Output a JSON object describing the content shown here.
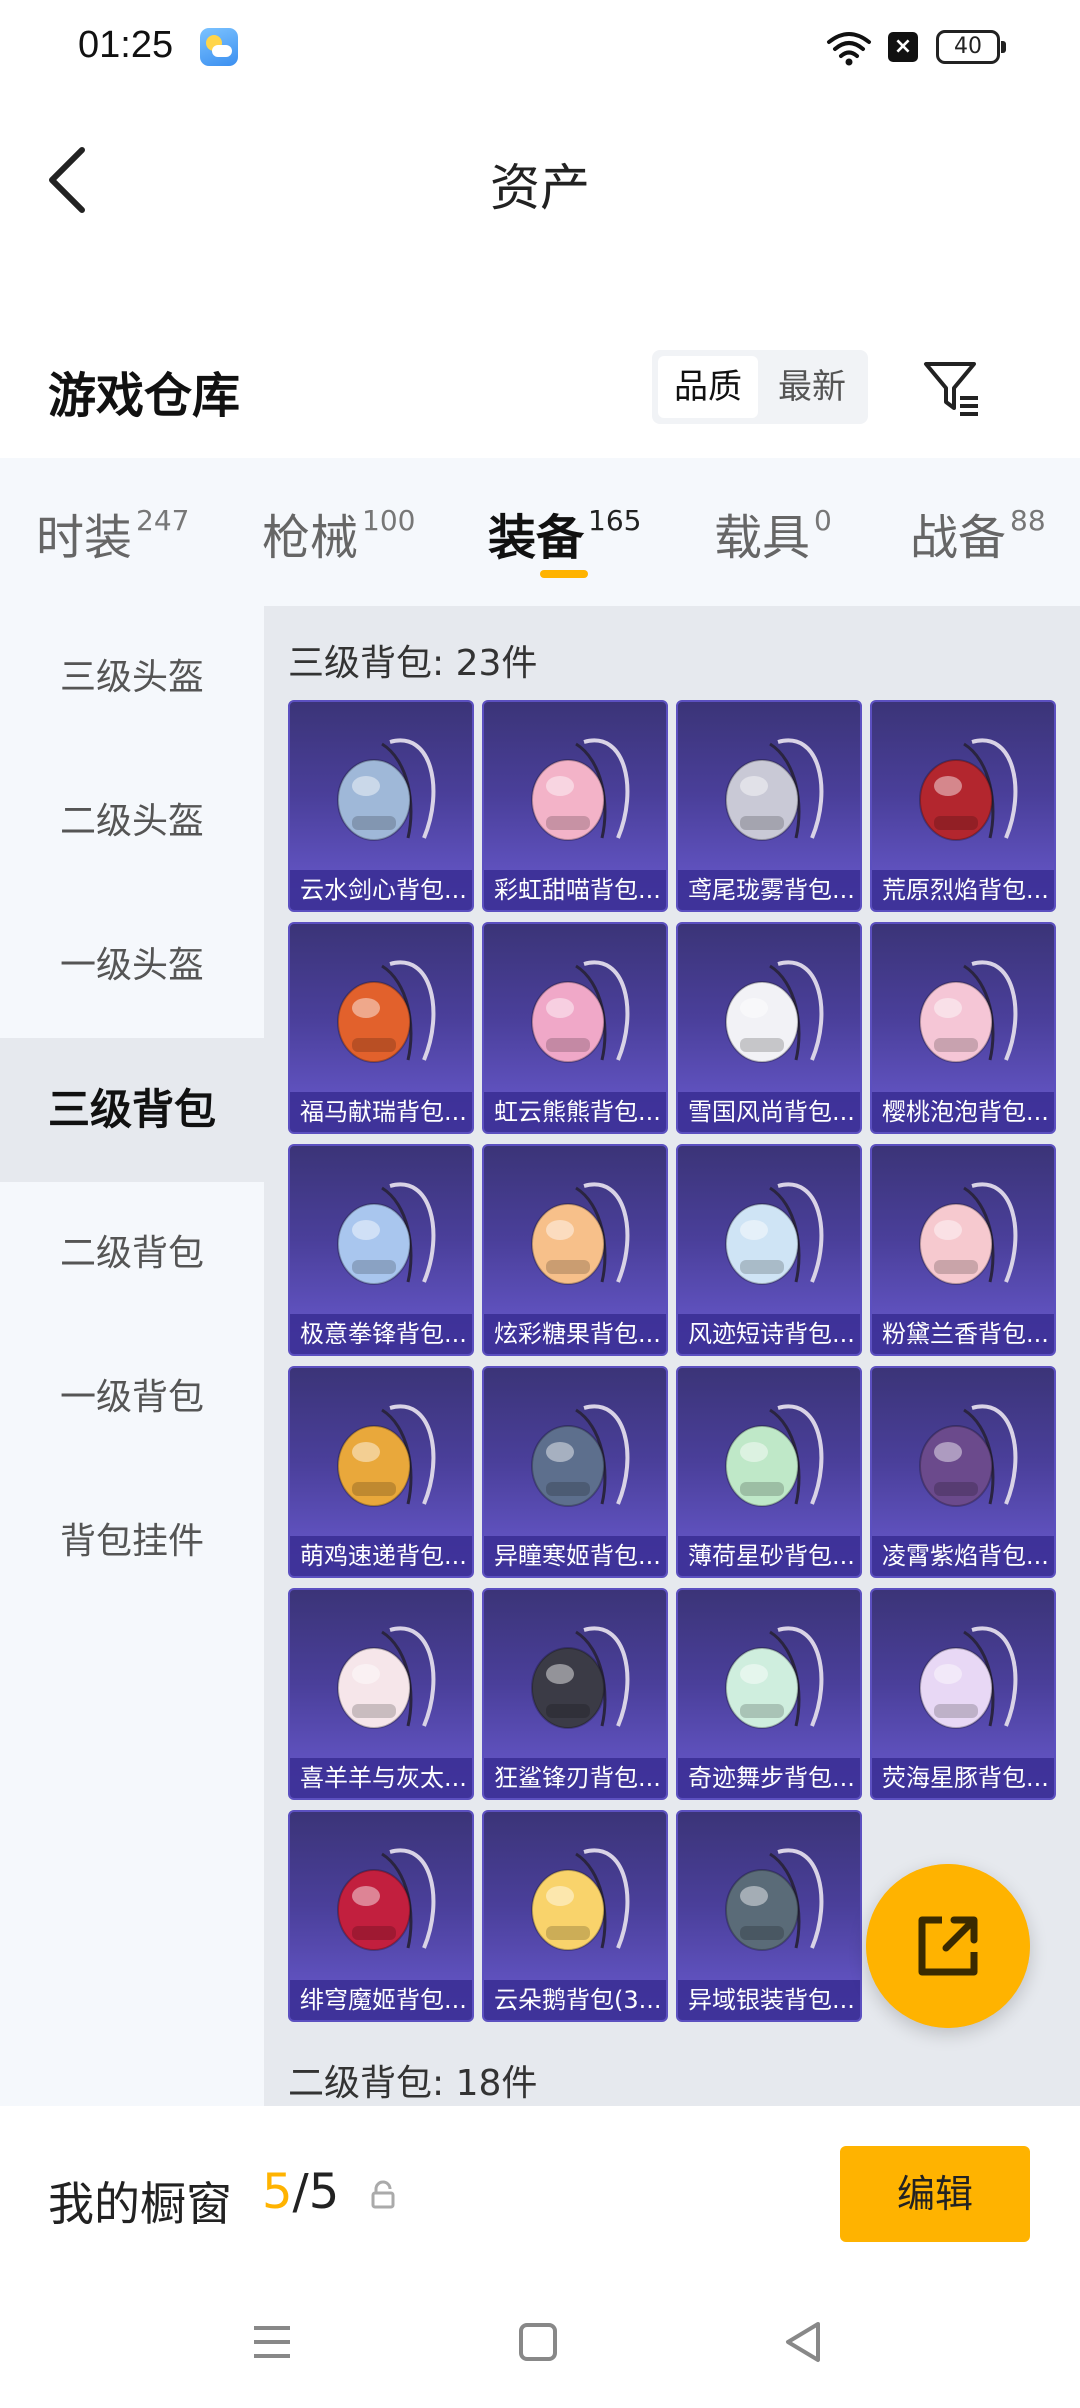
{
  "status_bar": {
    "time": "01:25",
    "battery": "40"
  },
  "header": {
    "title": "资产"
  },
  "warehouse": {
    "title": "游戏仓库",
    "sort_quality": "品质",
    "sort_latest": "最新"
  },
  "tabs": [
    {
      "label": "时装",
      "count": "247"
    },
    {
      "label": "枪械",
      "count": "100"
    },
    {
      "label": "装备",
      "count": "165"
    },
    {
      "label": "载具",
      "count": "0"
    },
    {
      "label": "战备",
      "count": "88"
    }
  ],
  "sidebar": {
    "items": [
      "三级头盔",
      "二级头盔",
      "一级头盔",
      "三级背包",
      "二级背包",
      "一级背包",
      "背包挂件"
    ]
  },
  "sections": {
    "level3_backpacks": "三级背包: 23件",
    "level2_backpacks": "二级背包: 18件"
  },
  "items": [
    "云水剑心背包...",
    "彩虹甜喵背包...",
    "鸢尾珑雾背包...",
    "荒原烈焰背包...",
    "福马献瑞背包...",
    "虹云熊熊背包...",
    "雪国风尚背包...",
    "樱桃泡泡背包...",
    "极意拳锋背包...",
    "炫彩糖果背包...",
    "风迹短诗背包...",
    "粉黛兰香背包...",
    "萌鸡速递背包...",
    "异瞳寒姬背包...",
    "薄荷星砂背包...",
    "凌霄紫焰背包...",
    "喜羊羊与灰太...",
    "狂鲨锋刃背包...",
    "奇迹舞步背包...",
    "荧海星豚背包...",
    "绯穹魔姬背包...",
    "云朵鹅背包(3...",
    "异域银装背包..."
  ],
  "item_colors": [
    "#9fb8d8",
    "#f3b3c8",
    "#c9c9d6",
    "#b3262e",
    "#e2612c",
    "#f0a8c8",
    "#f2f2f6",
    "#f5c6d6",
    "#a9c6ee",
    "#f7c08a",
    "#cfe4f5",
    "#f6c9cf",
    "#e9a83b",
    "#5d6f8d",
    "#bfe8c8",
    "#6b4a8c",
    "#f6e6ea",
    "#3b3b46",
    "#cfeede",
    "#e8d8f5",
    "#c21f3e",
    "#f9d36b",
    "#5a6b78"
  ],
  "showcase": {
    "label": "我的橱窗",
    "current": "5",
    "total": "/5",
    "edit_label": "编辑"
  },
  "colors": {
    "accent": "#ffb300",
    "card_bg": "#4a3f9a"
  }
}
